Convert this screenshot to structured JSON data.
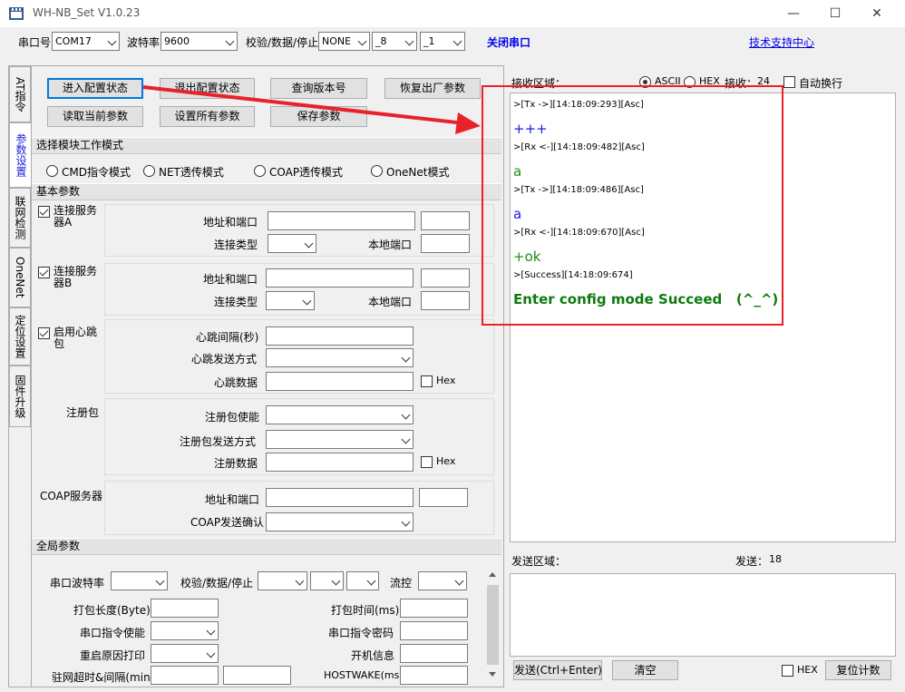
{
  "window": {
    "title": "WH-NB_Set V1.0.23",
    "min": "—",
    "max": "☐",
    "close": "✕"
  },
  "toolbar": {
    "port_label": "串口号",
    "port_value": "COM17",
    "baud_label": "波特率",
    "baud_value": "9600",
    "parity_label": "校验/数据/停止",
    "parity_value": "NONE",
    "data_value": "_8",
    "stop_value": "_1",
    "close_port": "关闭串口",
    "support": "技术支持中心"
  },
  "tabs": [
    "AT指令",
    "参数设置",
    "联网检测",
    "OneNet",
    "定位设置",
    "固件升级"
  ],
  "buttons": {
    "enter_config": "进入配置状态",
    "exit_config": "退出配置状态",
    "query_version": "查询版本号",
    "factory_reset": "恢复出厂参数",
    "read_params": "读取当前参数",
    "set_all": "设置所有参数",
    "save_params": "保存参数"
  },
  "mode": {
    "title": "选择模块工作模式",
    "options": [
      "CMD指令模式",
      "NET透传模式",
      "COAP透传模式",
      "OneNet模式"
    ]
  },
  "basic": {
    "title": "基本参数",
    "serverA": {
      "label": "连接服务器A",
      "addr": "地址和端口",
      "type": "连接类型",
      "local": "本地端口"
    },
    "serverB": {
      "label": "连接服务器B",
      "addr": "地址和端口",
      "type": "连接类型",
      "local": "本地端口"
    },
    "heartbeat": {
      "label": "启用心跳包",
      "interval": "心跳间隔(秒)",
      "send_mode": "心跳发送方式",
      "data": "心跳数据",
      "hex": "Hex"
    },
    "register": {
      "label": "注册包",
      "enable": "注册包使能",
      "send_mode": "注册包发送方式",
      "data": "注册数据",
      "hex": "Hex"
    },
    "coap": {
      "label": "COAP服务器",
      "addr": "地址和端口",
      "confirm": "COAP发送确认"
    }
  },
  "global": {
    "title": "全局参数",
    "baud": "串口波特率",
    "parity": "校验/数据/停止",
    "flow": "流控",
    "pack_len": "打包长度(Byte)",
    "pack_time": "打包时间(ms)",
    "cmd_enable": "串口指令使能",
    "cmd_pwd": "串口指令密码",
    "restart_print": "重启原因打印",
    "boot_info": "开机信息",
    "idle": "驻网超时&间隔(min)",
    "hostwake": "HOSTWAKE(ms)"
  },
  "receive": {
    "label": "接收区域：",
    "ascii": "ASCII",
    "hex": "HEX",
    "count_label": "接收：",
    "count": "24",
    "autowrap": "自动换行",
    "log": [
      {
        "kind": "meta",
        "text": ">[Tx ->][14:18:09:293][Asc]"
      },
      {
        "kind": "tx",
        "text": "+++"
      },
      {
        "kind": "meta",
        "text": ">[Rx <-][14:18:09:482][Asc]"
      },
      {
        "kind": "rx",
        "text": "a"
      },
      {
        "kind": "meta",
        "text": ">[Tx ->][14:18:09:486][Asc]"
      },
      {
        "kind": "tx",
        "text": "a"
      },
      {
        "kind": "meta",
        "text": ">[Rx <-][14:18:09:670][Asc]"
      },
      {
        "kind": "rx",
        "text": "+ok"
      },
      {
        "kind": "meta",
        "text": ">[Success][14:18:09:674]"
      },
      {
        "kind": "ok",
        "text": "Enter config mode Succeed   (^_^)"
      }
    ]
  },
  "send": {
    "label": "发送区域：",
    "count_label": "发送：",
    "count": "18",
    "send_btn": "发送(Ctrl+Enter)",
    "clear_btn": "清空",
    "hex": "HEX",
    "reset_btn": "复位计数"
  },
  "colors": {
    "annotation": "#e8222a",
    "link": "#0000ee",
    "focus": "#0078d7"
  }
}
